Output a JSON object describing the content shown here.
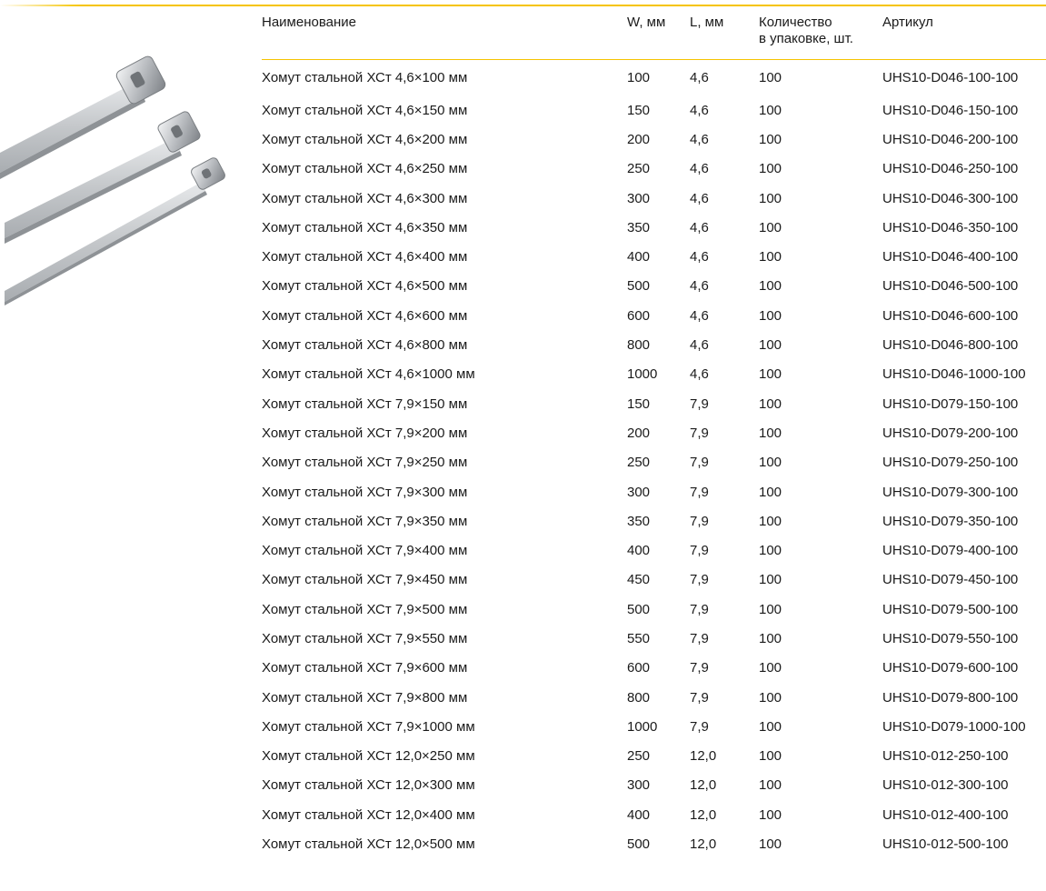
{
  "columns": {
    "name": "Наименование",
    "w": "W, мм",
    "l": "L, мм",
    "qty_line1": "Количество",
    "qty_line2": "в упаковке, шт.",
    "article": "Артикул"
  },
  "rows": [
    {
      "name": "Хомут стальной ХСт 4,6×100 мм",
      "w": "100",
      "l": "4,6",
      "qty": "100",
      "article": "UHS10-D046-100-100"
    },
    {
      "name": "Хомут стальной ХСт 4,6×150 мм",
      "w": "150",
      "l": "4,6",
      "qty": "100",
      "article": "UHS10-D046-150-100"
    },
    {
      "name": "Хомут стальной ХСт 4,6×200 мм",
      "w": "200",
      "l": "4,6",
      "qty": "100",
      "article": "UHS10-D046-200-100"
    },
    {
      "name": "Хомут стальной ХСт 4,6×250 мм",
      "w": "250",
      "l": "4,6",
      "qty": "100",
      "article": "UHS10-D046-250-100"
    },
    {
      "name": "Хомут стальной ХСт 4,6×300 мм",
      "w": "300",
      "l": "4,6",
      "qty": "100",
      "article": "UHS10-D046-300-100"
    },
    {
      "name": "Хомут стальной ХСт 4,6×350 мм",
      "w": "350",
      "l": "4,6",
      "qty": "100",
      "article": "UHS10-D046-350-100"
    },
    {
      "name": "Хомут стальной ХСт 4,6×400 мм",
      "w": "400",
      "l": "4,6",
      "qty": "100",
      "article": "UHS10-D046-400-100"
    },
    {
      "name": "Хомут стальной ХСт 4,6×500 мм",
      "w": "500",
      "l": "4,6",
      "qty": "100",
      "article": "UHS10-D046-500-100"
    },
    {
      "name": "Хомут стальной ХСт 4,6×600 мм",
      "w": "600",
      "l": "4,6",
      "qty": "100",
      "article": "UHS10-D046-600-100"
    },
    {
      "name": "Хомут стальной ХСт 4,6×800 мм",
      "w": "800",
      "l": "4,6",
      "qty": "100",
      "article": "UHS10-D046-800-100"
    },
    {
      "name": "Хомут стальной ХСт 4,6×1000 мм",
      "w": "1000",
      "l": "4,6",
      "qty": "100",
      "article": "UHS10-D046-1000-100"
    },
    {
      "name": "Хомут стальной ХСт 7,9×150 мм",
      "w": "150",
      "l": "7,9",
      "qty": "100",
      "article": "UHS10-D079-150-100"
    },
    {
      "name": "Хомут стальной ХСт 7,9×200 мм",
      "w": "200",
      "l": "7,9",
      "qty": "100",
      "article": "UHS10-D079-200-100"
    },
    {
      "name": "Хомут стальной ХСт 7,9×250 мм",
      "w": "250",
      "l": "7,9",
      "qty": "100",
      "article": "UHS10-D079-250-100"
    },
    {
      "name": "Хомут стальной ХСт 7,9×300 мм",
      "w": "300",
      "l": "7,9",
      "qty": "100",
      "article": "UHS10-D079-300-100"
    },
    {
      "name": "Хомут стальной ХСт 7,9×350 мм",
      "w": "350",
      "l": "7,9",
      "qty": "100",
      "article": "UHS10-D079-350-100"
    },
    {
      "name": "Хомут стальной ХСт 7,9×400 мм",
      "w": "400",
      "l": "7,9",
      "qty": "100",
      "article": "UHS10-D079-400-100"
    },
    {
      "name": "Хомут стальной ХСт 7,9×450 мм",
      "w": "450",
      "l": "7,9",
      "qty": "100",
      "article": "UHS10-D079-450-100"
    },
    {
      "name": "Хомут стальной ХСт 7,9×500 мм",
      "w": "500",
      "l": "7,9",
      "qty": "100",
      "article": "UHS10-D079-500-100"
    },
    {
      "name": "Хомут стальной ХСт 7,9×550 мм",
      "w": "550",
      "l": "7,9",
      "qty": "100",
      "article": "UHS10-D079-550-100"
    },
    {
      "name": "Хомут стальной ХСт 7,9×600 мм",
      "w": "600",
      "l": "7,9",
      "qty": "100",
      "article": "UHS10-D079-600-100"
    },
    {
      "name": "Хомут стальной ХСт 7,9×800 мм",
      "w": "800",
      "l": "7,9",
      "qty": "100",
      "article": "UHS10-D079-800-100"
    },
    {
      "name": "Хомут стальной ХСт 7,9×1000 мм",
      "w": "1000",
      "l": "7,9",
      "qty": "100",
      "article": "UHS10-D079-1000-100"
    },
    {
      "name": "Хомут стальной ХСт 12,0×250 мм",
      "w": "250",
      "l": "12,0",
      "qty": "100",
      "article": "UHS10-012-250-100"
    },
    {
      "name": "Хомут стальной ХСт 12,0×300 мм",
      "w": "300",
      "l": "12,0",
      "qty": "100",
      "article": "UHS10-012-300-100"
    },
    {
      "name": "Хомут стальной ХСт 12,0×400 мм",
      "w": "400",
      "l": "12,0",
      "qty": "100",
      "article": "UHS10-012-400-100"
    },
    {
      "name": "Хомут стальной ХСт 12,0×500 мм",
      "w": "500",
      "l": "12,0",
      "qty": "100",
      "article": "UHS10-012-500-100"
    }
  ],
  "colors": {
    "accent_rule": "#f5c400",
    "text": "#1a1a1a"
  }
}
